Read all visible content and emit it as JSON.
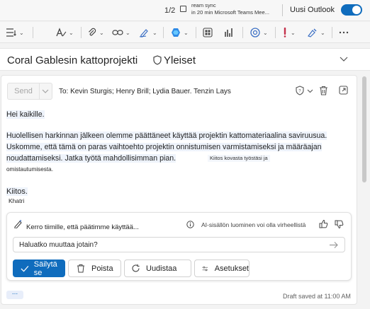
{
  "topbar": {
    "pager": "1/2",
    "reminder_line1": "ream sync",
    "reminder_line2": "in 20 min Microsoft Teams Mee...",
    "new_outlook_label": "Uusi Outlook",
    "new_outlook_on": true
  },
  "toolbar": {
    "icons": [
      "format-list-icon",
      "format-text-icon",
      "attach-icon",
      "link-icon",
      "signature-icon",
      "copilot-icon",
      "apps-icon",
      "chart-icon",
      "loop-icon",
      "importance-icon",
      "sensitivity-icon",
      "more-icon"
    ]
  },
  "subject": {
    "title": "Coral Gablesin kattoprojekti",
    "sensitivity_label": "Yleiset"
  },
  "compose": {
    "send_label": "Send",
    "to_line": "To: Kevin Sturgis; Henry Brill; Lydia Bauer. Tenzin Lays",
    "greeting": "Hei kaikille.",
    "para1": "Huolellisen harkinnan jälkeen olemme päättäneet käyttää projektin kattomateriaalina saviruusua.",
    "para2_line1": "Uskomme, että tämä on paras vaihtoehto projektin onnistumisen varmistamiseksi ja määräajan",
    "para2_line2": "noudattamiseksi. Jatka työtä mahdollisimman pian.",
    "suggestion_line1": "Kiitos kovasta työstäsi ja",
    "suggestion_line2": "omistautumisesta.",
    "closing": "Kiitos.",
    "signature": "Khatri"
  },
  "copilot": {
    "prompt_summary": "Kerro tiimille, että päätimme käyttää...",
    "disclaimer": "AI-sisällön luominen voi olla virheellistä",
    "input_value": "Haluatko muuttaa jotain?",
    "keep_label": "Säilytä se",
    "discard_label": "Poista",
    "regenerate_label": "Uudistaa",
    "settings_label": "Asetukset"
  },
  "footer": {
    "more_label": "...",
    "draft_status": "Draft saved at 11:00 AM"
  },
  "colors": {
    "accent": "#0f6cbd",
    "highlight": "#eef3fb"
  }
}
